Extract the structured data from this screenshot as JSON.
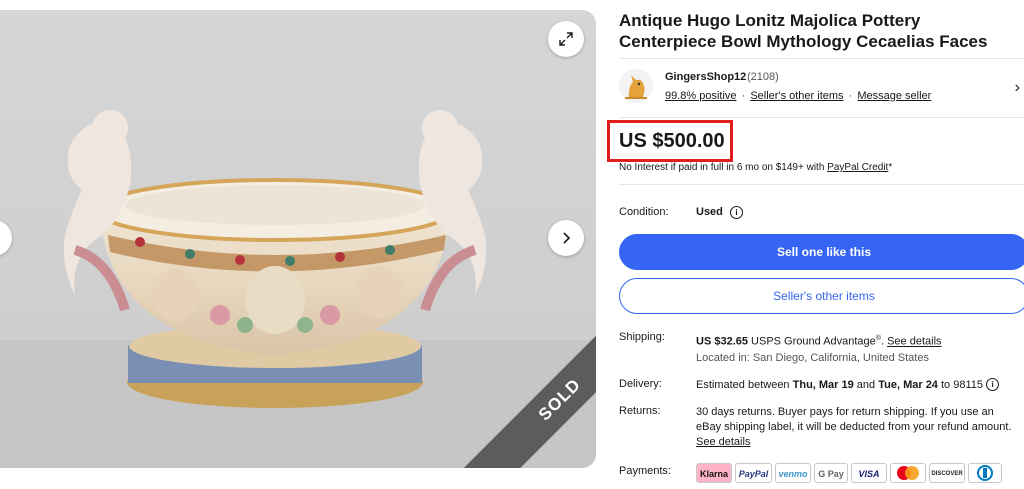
{
  "gallery": {
    "sold_label": "SOLD",
    "expand_icon": "expand-icon",
    "next_icon": "chevron-right-icon"
  },
  "listing": {
    "title": "Antique Hugo Lonitz Majolica Pottery Centerpiece Bowl Mythology Cecaelias Faces"
  },
  "seller": {
    "name": "GingersShop12",
    "feedback_count": "(2108)",
    "positive": "99.8% positive",
    "sep": "·",
    "other_items": "Seller's other items",
    "message": "Message seller",
    "chevron": "›"
  },
  "price": {
    "amount": "US $500.00",
    "finance_prefix": "No Interest if paid in full in 6 mo on $149+ with ",
    "finance_link": "PayPal Credit",
    "finance_suffix": "*"
  },
  "condition": {
    "label": "Condition:",
    "value": "Used",
    "info": "i"
  },
  "buttons": {
    "sell_like": "Sell one like this",
    "other_items": "Seller's other items"
  },
  "shipping": {
    "label": "Shipping:",
    "cost": "US $32.65",
    "service": " USPS Ground Advantage",
    "reg": "®",
    "dot": ". ",
    "details": "See details",
    "location": "Located in: San Diego, California, United States"
  },
  "delivery": {
    "label": "Delivery:",
    "prefix": "Estimated between ",
    "start": "Thu, Mar 19",
    "and": " and ",
    "end": "Tue, Mar 24",
    "suffix": " to 98115 ",
    "info": "i"
  },
  "returns": {
    "label": "Returns:",
    "text": "30 days returns. Buyer pays for return shipping. If you use an eBay shipping label, it will be deducted from your refund amount.",
    "details": "See details"
  },
  "payments": {
    "label": "Payments:",
    "methods": [
      "Klarna",
      "PayPal",
      "venmo",
      "G Pay",
      "VISA",
      "",
      "DISCOVER",
      ""
    ]
  },
  "colors": {
    "primary": "#3665f3",
    "highlight": "#e11d1d",
    "sold_ribbon": "#5c5c5c"
  }
}
